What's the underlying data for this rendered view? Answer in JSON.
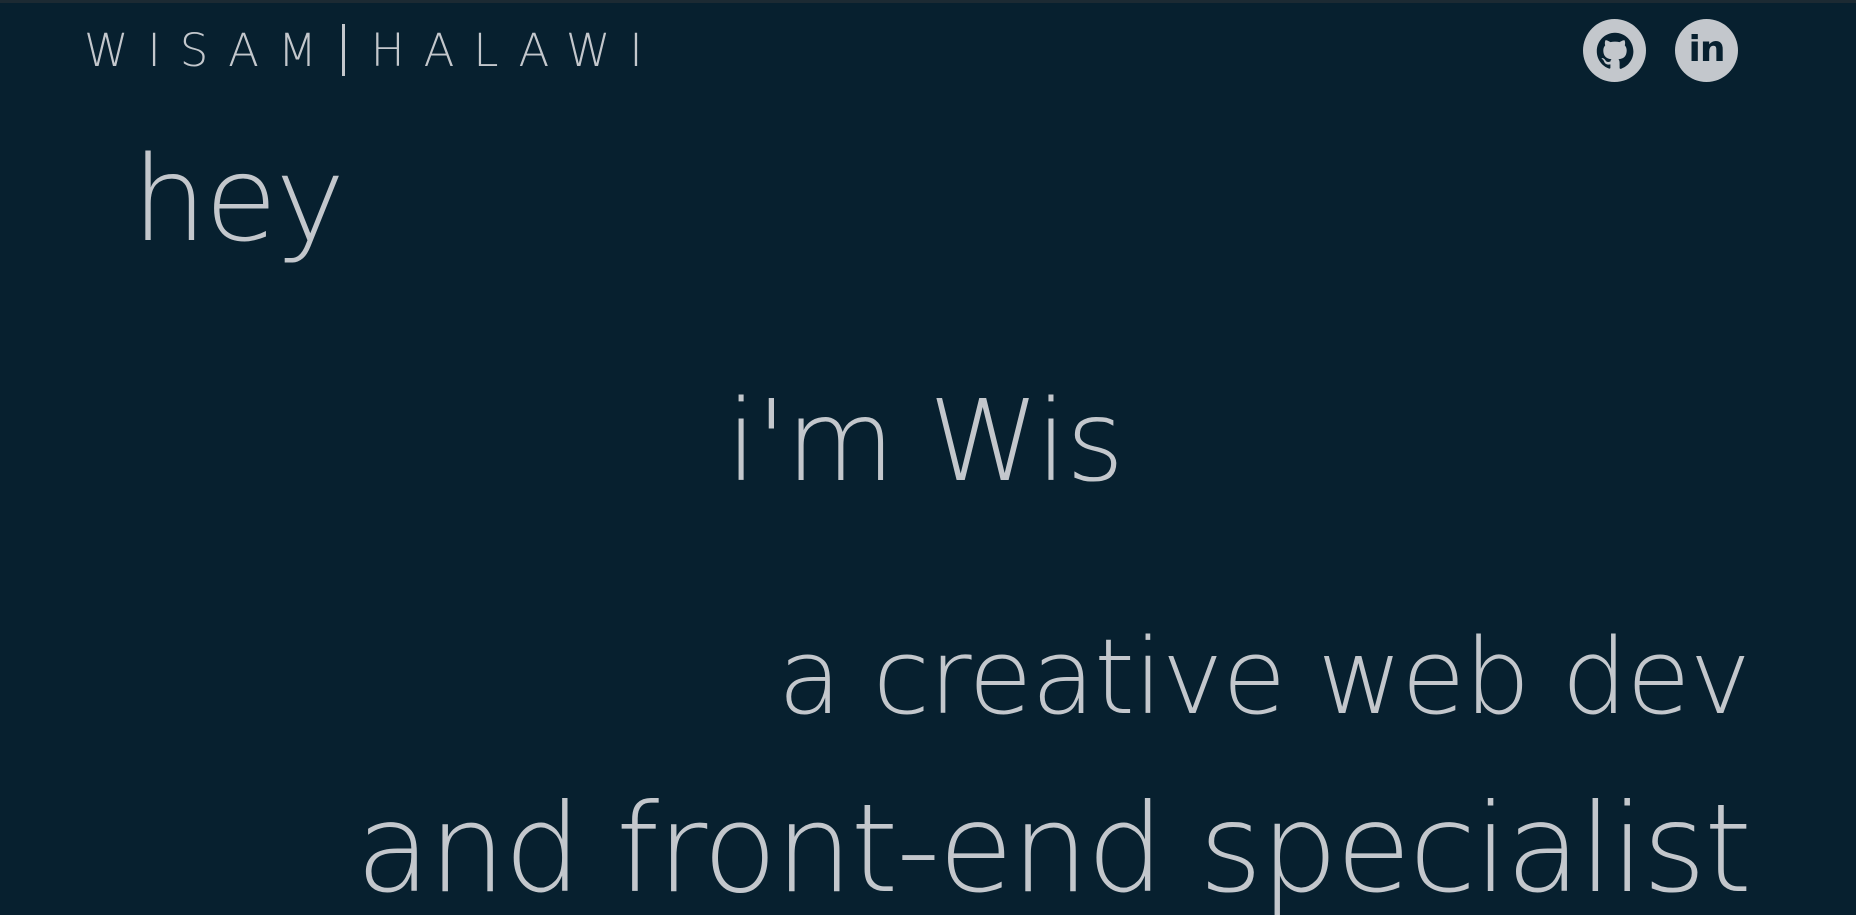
{
  "header": {
    "brand_first": "WISAM",
    "brand_last": "HALAWI",
    "social": [
      {
        "name": "github",
        "icon": "github-icon"
      },
      {
        "name": "linkedin",
        "icon": "linkedin-icon",
        "glyph": "in"
      }
    ]
  },
  "hero": {
    "greeting": "hey",
    "intro": "i'm Wis",
    "role_line1": "a creative web dev",
    "role_line2": "and front-end specialist"
  },
  "colors": {
    "background": "#07202f",
    "text": "#c3c7cc"
  }
}
